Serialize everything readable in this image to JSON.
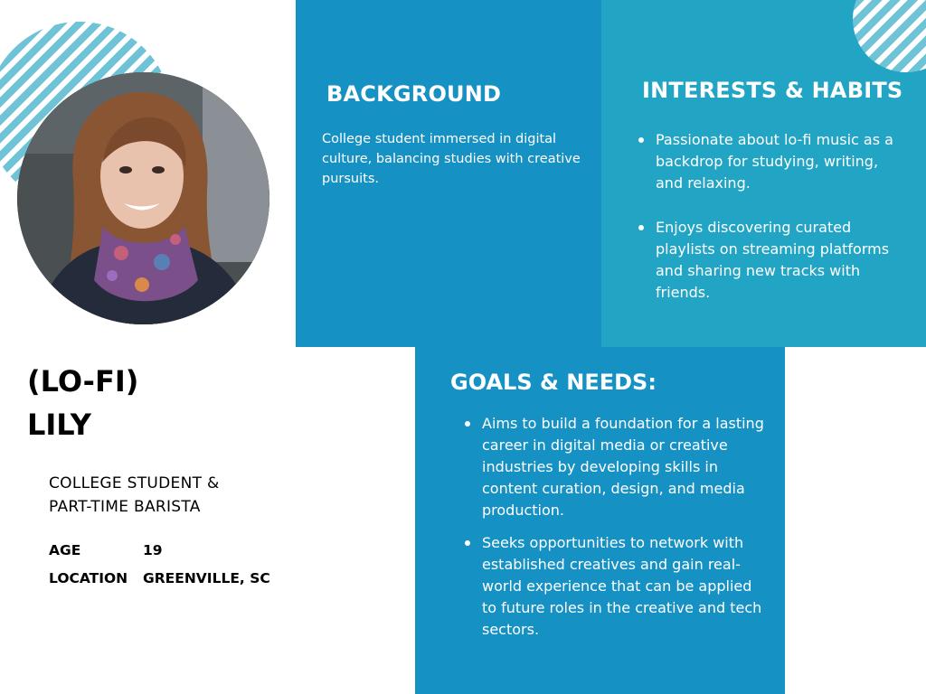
{
  "persona": {
    "name_line1": "(LO-FI)",
    "name_line2": "LILY",
    "role_line1": "COLLEGE STUDENT &",
    "role_line2": "PART-TIME BARISTA",
    "facts": [
      {
        "label": "AGE",
        "value": "19"
      },
      {
        "label": "LOCATION",
        "value": "GREENVILLE, SC"
      }
    ]
  },
  "background": {
    "heading": "BACKGROUND",
    "text": "College student immersed in digital culture, balancing studies with creative pursuits."
  },
  "interests": {
    "heading": "INTERESTS & HABITS",
    "items": [
      "Passionate about lo-fi music as a backdrop for studying, writing, and relaxing.",
      "Enjoys discovering curated playlists on streaming platforms and sharing new tracks with friends."
    ]
  },
  "goals": {
    "heading": "GOALS & NEEDS:",
    "items": [
      "Aims to build a foundation for a lasting career in digital media or creative industries by developing skills in content curation, design, and media production.",
      " Seeks opportunities to network with established creatives and gain real-world experience that can be applied to future roles in the creative and tech sectors."
    ]
  },
  "colors": {
    "panel_blue": "#1691c4",
    "panel_teal": "#22a4c4",
    "stripe": "#6ec3d6"
  }
}
